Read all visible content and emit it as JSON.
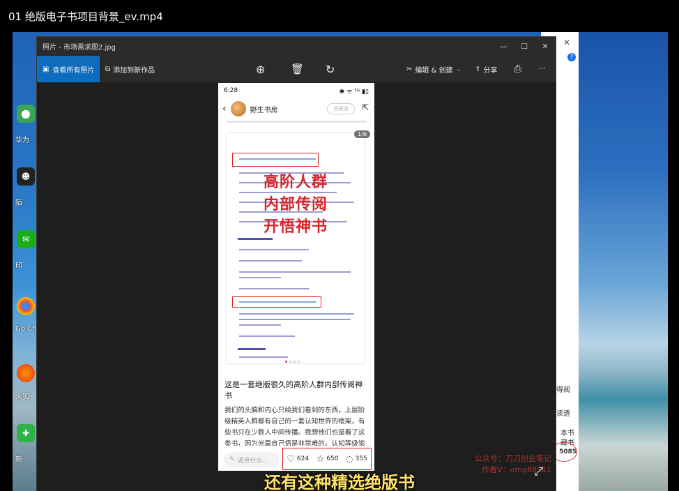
{
  "video": {
    "title": "01 绝版电子书项目背景_ev.mp4"
  },
  "photos_window": {
    "title": "照片 - 市场需求图2.jpg",
    "controls": {
      "minimize": "—",
      "maximize": "☐",
      "close": "✕"
    },
    "toolbar": {
      "view_all": "查看所有照片",
      "add_to_creation": "添加到新作品",
      "edit_create": "编辑 & 创建",
      "share": "分享",
      "more": "···"
    }
  },
  "phone": {
    "status_time": "6:28",
    "status_icons": "✱ ᯤ ⁵ᴳ ▮▯",
    "account_name": "野生书房",
    "follow_label": "已关注",
    "image_counter": "1/6",
    "image_overlay_lines": [
      "高阶人群",
      "内部传阅",
      "开悟神书"
    ],
    "post_title": "这是一套绝版很久的高阶人群内部传阅神书",
    "post_body": "我们的头脑和内心只给我们看到的东西，上层阶级精英人群都有自己的一套认知世界的框架，有些书只在少数人中间传播。我想他们也是看了这类书，因为光靠自己悟是非常难的。认知等级锁约等于阶层等级锁。绝版很久，终于",
    "comment_placeholder": "说点什么...",
    "likes": "624",
    "stars": "650",
    "comments": "355"
  },
  "watermark": {
    "line1": "公众号：刀刀创业笔记",
    "line2": "作者V：omg88511"
  },
  "browser_peek": {
    "text1": "得阅",
    "text2": "读透",
    "text3": "本书",
    "text4": "藏书",
    "count": "5085",
    "help": "?",
    "close": "✕"
  },
  "subtitle": "还有这种精选绝版书",
  "desktop_labels": [
    "华为",
    "陌",
    "印",
    "Go Ch",
    "火狐",
    "新"
  ]
}
